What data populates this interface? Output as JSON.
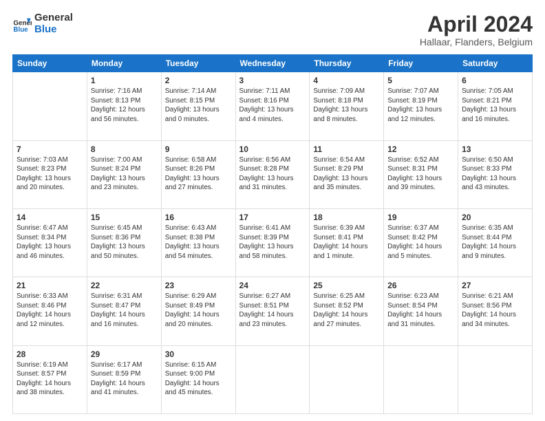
{
  "header": {
    "logo_line1": "General",
    "logo_line2": "Blue",
    "title": "April 2024",
    "subtitle": "Hallaar, Flanders, Belgium"
  },
  "weekdays": [
    "Sunday",
    "Monday",
    "Tuesday",
    "Wednesday",
    "Thursday",
    "Friday",
    "Saturday"
  ],
  "weeks": [
    [
      {
        "day": "",
        "info": ""
      },
      {
        "day": "1",
        "info": "Sunrise: 7:16 AM\nSunset: 8:13 PM\nDaylight: 12 hours\nand 56 minutes."
      },
      {
        "day": "2",
        "info": "Sunrise: 7:14 AM\nSunset: 8:15 PM\nDaylight: 13 hours\nand 0 minutes."
      },
      {
        "day": "3",
        "info": "Sunrise: 7:11 AM\nSunset: 8:16 PM\nDaylight: 13 hours\nand 4 minutes."
      },
      {
        "day": "4",
        "info": "Sunrise: 7:09 AM\nSunset: 8:18 PM\nDaylight: 13 hours\nand 8 minutes."
      },
      {
        "day": "5",
        "info": "Sunrise: 7:07 AM\nSunset: 8:19 PM\nDaylight: 13 hours\nand 12 minutes."
      },
      {
        "day": "6",
        "info": "Sunrise: 7:05 AM\nSunset: 8:21 PM\nDaylight: 13 hours\nand 16 minutes."
      }
    ],
    [
      {
        "day": "7",
        "info": "Sunrise: 7:03 AM\nSunset: 8:23 PM\nDaylight: 13 hours\nand 20 minutes."
      },
      {
        "day": "8",
        "info": "Sunrise: 7:00 AM\nSunset: 8:24 PM\nDaylight: 13 hours\nand 23 minutes."
      },
      {
        "day": "9",
        "info": "Sunrise: 6:58 AM\nSunset: 8:26 PM\nDaylight: 13 hours\nand 27 minutes."
      },
      {
        "day": "10",
        "info": "Sunrise: 6:56 AM\nSunset: 8:28 PM\nDaylight: 13 hours\nand 31 minutes."
      },
      {
        "day": "11",
        "info": "Sunrise: 6:54 AM\nSunset: 8:29 PM\nDaylight: 13 hours\nand 35 minutes."
      },
      {
        "day": "12",
        "info": "Sunrise: 6:52 AM\nSunset: 8:31 PM\nDaylight: 13 hours\nand 39 minutes."
      },
      {
        "day": "13",
        "info": "Sunrise: 6:50 AM\nSunset: 8:33 PM\nDaylight: 13 hours\nand 43 minutes."
      }
    ],
    [
      {
        "day": "14",
        "info": "Sunrise: 6:47 AM\nSunset: 8:34 PM\nDaylight: 13 hours\nand 46 minutes."
      },
      {
        "day": "15",
        "info": "Sunrise: 6:45 AM\nSunset: 8:36 PM\nDaylight: 13 hours\nand 50 minutes."
      },
      {
        "day": "16",
        "info": "Sunrise: 6:43 AM\nSunset: 8:38 PM\nDaylight: 13 hours\nand 54 minutes."
      },
      {
        "day": "17",
        "info": "Sunrise: 6:41 AM\nSunset: 8:39 PM\nDaylight: 13 hours\nand 58 minutes."
      },
      {
        "day": "18",
        "info": "Sunrise: 6:39 AM\nSunset: 8:41 PM\nDaylight: 14 hours\nand 1 minute."
      },
      {
        "day": "19",
        "info": "Sunrise: 6:37 AM\nSunset: 8:42 PM\nDaylight: 14 hours\nand 5 minutes."
      },
      {
        "day": "20",
        "info": "Sunrise: 6:35 AM\nSunset: 8:44 PM\nDaylight: 14 hours\nand 9 minutes."
      }
    ],
    [
      {
        "day": "21",
        "info": "Sunrise: 6:33 AM\nSunset: 8:46 PM\nDaylight: 14 hours\nand 12 minutes."
      },
      {
        "day": "22",
        "info": "Sunrise: 6:31 AM\nSunset: 8:47 PM\nDaylight: 14 hours\nand 16 minutes."
      },
      {
        "day": "23",
        "info": "Sunrise: 6:29 AM\nSunset: 8:49 PM\nDaylight: 14 hours\nand 20 minutes."
      },
      {
        "day": "24",
        "info": "Sunrise: 6:27 AM\nSunset: 8:51 PM\nDaylight: 14 hours\nand 23 minutes."
      },
      {
        "day": "25",
        "info": "Sunrise: 6:25 AM\nSunset: 8:52 PM\nDaylight: 14 hours\nand 27 minutes."
      },
      {
        "day": "26",
        "info": "Sunrise: 6:23 AM\nSunset: 8:54 PM\nDaylight: 14 hours\nand 31 minutes."
      },
      {
        "day": "27",
        "info": "Sunrise: 6:21 AM\nSunset: 8:56 PM\nDaylight: 14 hours\nand 34 minutes."
      }
    ],
    [
      {
        "day": "28",
        "info": "Sunrise: 6:19 AM\nSunset: 8:57 PM\nDaylight: 14 hours\nand 38 minutes."
      },
      {
        "day": "29",
        "info": "Sunrise: 6:17 AM\nSunset: 8:59 PM\nDaylight: 14 hours\nand 41 minutes."
      },
      {
        "day": "30",
        "info": "Sunrise: 6:15 AM\nSunset: 9:00 PM\nDaylight: 14 hours\nand 45 minutes."
      },
      {
        "day": "",
        "info": ""
      },
      {
        "day": "",
        "info": ""
      },
      {
        "day": "",
        "info": ""
      },
      {
        "day": "",
        "info": ""
      }
    ]
  ]
}
